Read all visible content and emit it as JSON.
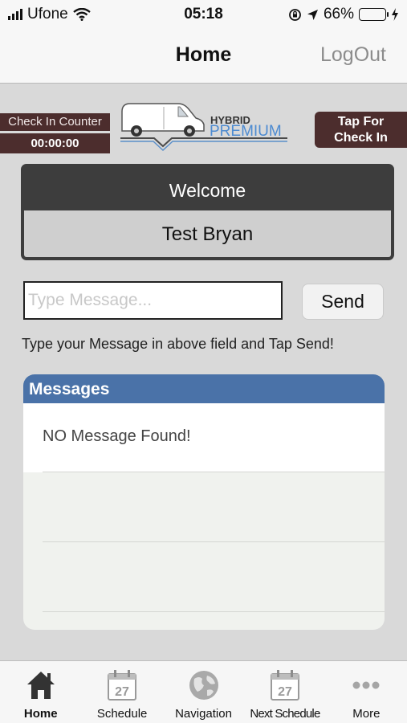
{
  "status_bar": {
    "carrier": "Ufone",
    "time": "05:18",
    "battery": "66%",
    "battery_level": 0.66
  },
  "nav": {
    "title": "Home",
    "logout": "LogOut"
  },
  "checkin_counter": {
    "label": "Check In Counter",
    "time": "00:00:00"
  },
  "logo": {
    "line1": "HYBRID",
    "line2": "PREMIUM"
  },
  "tap_button": {
    "line1": "Tap For",
    "line2": "Check In"
  },
  "welcome": {
    "title": "Welcome",
    "name": "Test Bryan"
  },
  "message": {
    "placeholder": "Type Message...",
    "value": "",
    "send": "Send",
    "hint": "Type your Message in above field and Tap Send!"
  },
  "messages_panel": {
    "title": "Messages",
    "empty": "NO Message Found!"
  },
  "tabs": [
    {
      "label": "Home",
      "icon": "home-icon"
    },
    {
      "label": "Schedule",
      "icon": "calendar-icon",
      "day": "27"
    },
    {
      "label": "Navigation",
      "icon": "globe-icon"
    },
    {
      "label": "Next Schedule",
      "icon": "calendar-icon",
      "day": "27"
    },
    {
      "label": "More",
      "icon": "more-dots-icon"
    }
  ],
  "colors": {
    "brand_dark": "#4c2d2d",
    "messages_header": "#4a72a8",
    "battery": "#f4c20d"
  }
}
